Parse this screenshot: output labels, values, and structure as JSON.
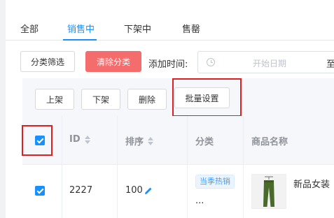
{
  "tabs": [
    {
      "label": "全部"
    },
    {
      "label": "销售中"
    },
    {
      "label": "下架中"
    },
    {
      "label": "售罄"
    }
  ],
  "filters": {
    "category_filter_label": "分类筛选",
    "clear_category_label": "清除分类",
    "add_time_label": "添加时间:",
    "start_date_placeholder": "开始日期",
    "range_separator": "至"
  },
  "actions": {
    "list_label": "上架",
    "delist_label": "下架",
    "delete_label": "删除",
    "batch_settings_label": "批量设置"
  },
  "table": {
    "headers": {
      "id": "ID",
      "sort": "排序",
      "category": "分类",
      "name": "商品名称"
    },
    "rows": [
      {
        "checked": true,
        "id": "2227",
        "sort": "100",
        "category_tag": "当季热销",
        "category_more": "...",
        "name": "新品女装"
      }
    ]
  },
  "colors": {
    "accent": "#1890ff",
    "danger_button": "#f56c6c",
    "highlight_box": "#e02020"
  }
}
